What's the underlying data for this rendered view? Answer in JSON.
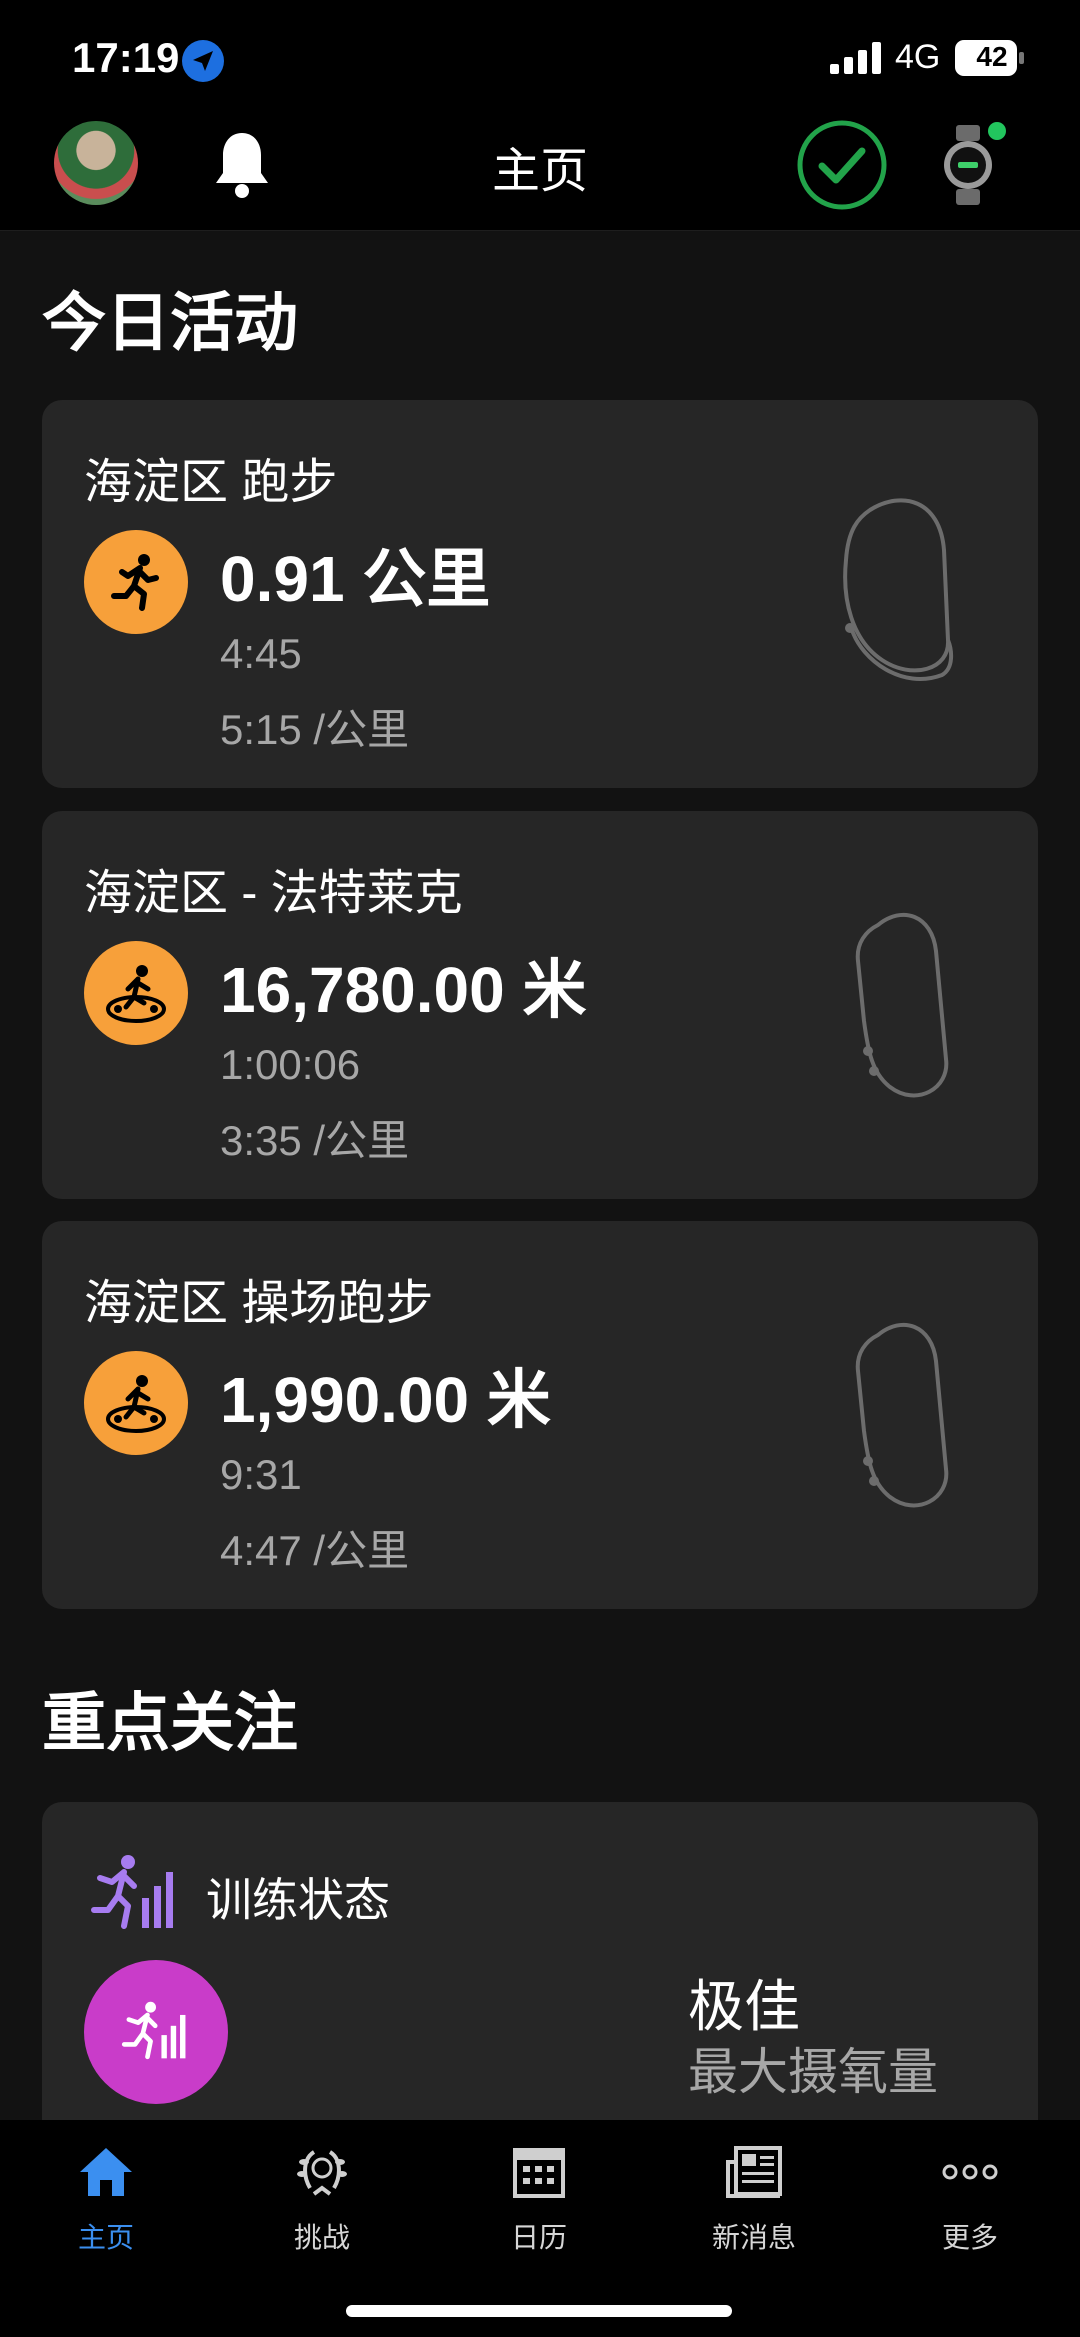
{
  "status_bar": {
    "time": "17:19",
    "network": "4G",
    "battery": "42"
  },
  "header": {
    "title": "主页"
  },
  "today_section": {
    "title": "今日活动"
  },
  "activities": [
    {
      "title": "海淀区 跑步",
      "type_icon": "running-icon",
      "distance": "0.91 公里",
      "duration": "4:45",
      "pace": "5:15 /公里"
    },
    {
      "title": "海淀区 - 法特莱克",
      "type_icon": "treadmill-icon",
      "distance": "16,780.00 米",
      "duration": "1:00:06",
      "pace": "3:35 /公里"
    },
    {
      "title": "海淀区 操场跑步",
      "type_icon": "treadmill-icon",
      "distance": "1,990.00 米",
      "duration": "9:31",
      "pace": "4:47 /公里"
    }
  ],
  "focus_section": {
    "title": "重点关注"
  },
  "training_status": {
    "label": "训练状态",
    "status": "极佳",
    "metric": "最大摄氧量"
  },
  "tabs": [
    {
      "label": "主页",
      "icon": "home-icon",
      "active": true
    },
    {
      "label": "挑战",
      "icon": "laurel-icon",
      "active": false
    },
    {
      "label": "日历",
      "icon": "calendar-icon",
      "active": false
    },
    {
      "label": "新消息",
      "icon": "news-icon",
      "active": false
    },
    {
      "label": "更多",
      "icon": "more-icon",
      "active": false
    }
  ],
  "colors": {
    "accent": "#3b8ff0",
    "activity_icon_bg": "#f7a03a",
    "training_status_bg": "#c93cc9",
    "check_green": "#22a34a"
  }
}
